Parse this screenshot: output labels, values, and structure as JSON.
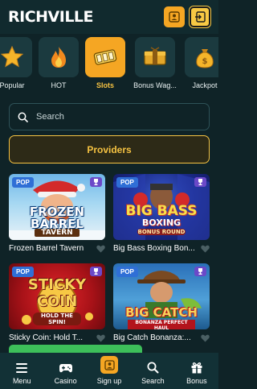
{
  "header": {
    "logo": "RICHVILLE",
    "actions": [
      {
        "icon": "login-icon"
      },
      {
        "icon": "signin-icon"
      }
    ]
  },
  "categories": [
    {
      "label": "Popular",
      "icon": "star-icon",
      "active": false
    },
    {
      "label": "HOT",
      "icon": "flame-icon",
      "active": false
    },
    {
      "label": "Slots",
      "icon": "slot-reel-icon",
      "active": true
    },
    {
      "label": "Bonus Wag...",
      "icon": "bonus-chest-icon",
      "active": false
    },
    {
      "label": "Jackpot",
      "icon": "money-bag-icon",
      "active": false
    }
  ],
  "search": {
    "placeholder": "Search"
  },
  "providers": {
    "label": "Providers"
  },
  "games": [
    {
      "title": "Frozen Barrel Tavern",
      "badge": "POP",
      "art_text": [
        "FROZEN",
        "BARREL",
        "TAVERN"
      ]
    },
    {
      "title": "Big Bass Boxing Bon...",
      "badge": "POP",
      "art_text": [
        "BIG BASS",
        "BOXING",
        "BONUS ROUND"
      ]
    },
    {
      "title": "Sticky Coin: Hold T...",
      "badge": "POP",
      "art_text": [
        "STICKY",
        "COIN",
        "HOLD THE SPIN!"
      ]
    },
    {
      "title": "Big Catch Bonanza:...",
      "badge": "POP",
      "art_text": [
        "BIG CATCH",
        "BONANZA PERFECT HAUL"
      ]
    }
  ],
  "nav": [
    {
      "label": "Menu",
      "icon": "hamburger-icon"
    },
    {
      "label": "Casino",
      "icon": "gamepad-icon"
    },
    {
      "label": "Sign up",
      "icon": "signup-icon"
    },
    {
      "label": "Search",
      "icon": "search-icon"
    },
    {
      "label": "Bonus",
      "icon": "gift-icon"
    }
  ],
  "colors": {
    "background": "#0f2327",
    "accent": "#f5a623",
    "accent_text": "#f5c242",
    "badge": "#2f6fd6",
    "nav": "#123136"
  }
}
